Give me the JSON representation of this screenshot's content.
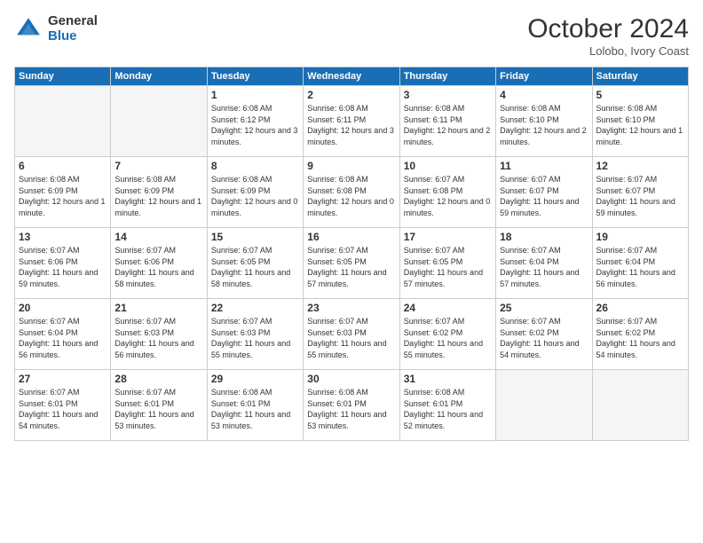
{
  "logo": {
    "general": "General",
    "blue": "Blue"
  },
  "header": {
    "month": "October 2024",
    "location": "Lolobo, Ivory Coast"
  },
  "weekdays": [
    "Sunday",
    "Monday",
    "Tuesday",
    "Wednesday",
    "Thursday",
    "Friday",
    "Saturday"
  ],
  "weeks": [
    [
      {
        "day": "",
        "info": ""
      },
      {
        "day": "",
        "info": ""
      },
      {
        "day": "1",
        "info": "Sunrise: 6:08 AM\nSunset: 6:12 PM\nDaylight: 12 hours\nand 3 minutes."
      },
      {
        "day": "2",
        "info": "Sunrise: 6:08 AM\nSunset: 6:11 PM\nDaylight: 12 hours\nand 3 minutes."
      },
      {
        "day": "3",
        "info": "Sunrise: 6:08 AM\nSunset: 6:11 PM\nDaylight: 12 hours\nand 2 minutes."
      },
      {
        "day": "4",
        "info": "Sunrise: 6:08 AM\nSunset: 6:10 PM\nDaylight: 12 hours\nand 2 minutes."
      },
      {
        "day": "5",
        "info": "Sunrise: 6:08 AM\nSunset: 6:10 PM\nDaylight: 12 hours\nand 1 minute."
      }
    ],
    [
      {
        "day": "6",
        "info": "Sunrise: 6:08 AM\nSunset: 6:09 PM\nDaylight: 12 hours\nand 1 minute."
      },
      {
        "day": "7",
        "info": "Sunrise: 6:08 AM\nSunset: 6:09 PM\nDaylight: 12 hours\nand 1 minute."
      },
      {
        "day": "8",
        "info": "Sunrise: 6:08 AM\nSunset: 6:09 PM\nDaylight: 12 hours\nand 0 minutes."
      },
      {
        "day": "9",
        "info": "Sunrise: 6:08 AM\nSunset: 6:08 PM\nDaylight: 12 hours\nand 0 minutes."
      },
      {
        "day": "10",
        "info": "Sunrise: 6:07 AM\nSunset: 6:08 PM\nDaylight: 12 hours\nand 0 minutes."
      },
      {
        "day": "11",
        "info": "Sunrise: 6:07 AM\nSunset: 6:07 PM\nDaylight: 11 hours\nand 59 minutes."
      },
      {
        "day": "12",
        "info": "Sunrise: 6:07 AM\nSunset: 6:07 PM\nDaylight: 11 hours\nand 59 minutes."
      }
    ],
    [
      {
        "day": "13",
        "info": "Sunrise: 6:07 AM\nSunset: 6:06 PM\nDaylight: 11 hours\nand 59 minutes."
      },
      {
        "day": "14",
        "info": "Sunrise: 6:07 AM\nSunset: 6:06 PM\nDaylight: 11 hours\nand 58 minutes."
      },
      {
        "day": "15",
        "info": "Sunrise: 6:07 AM\nSunset: 6:05 PM\nDaylight: 11 hours\nand 58 minutes."
      },
      {
        "day": "16",
        "info": "Sunrise: 6:07 AM\nSunset: 6:05 PM\nDaylight: 11 hours\nand 57 minutes."
      },
      {
        "day": "17",
        "info": "Sunrise: 6:07 AM\nSunset: 6:05 PM\nDaylight: 11 hours\nand 57 minutes."
      },
      {
        "day": "18",
        "info": "Sunrise: 6:07 AM\nSunset: 6:04 PM\nDaylight: 11 hours\nand 57 minutes."
      },
      {
        "day": "19",
        "info": "Sunrise: 6:07 AM\nSunset: 6:04 PM\nDaylight: 11 hours\nand 56 minutes."
      }
    ],
    [
      {
        "day": "20",
        "info": "Sunrise: 6:07 AM\nSunset: 6:04 PM\nDaylight: 11 hours\nand 56 minutes."
      },
      {
        "day": "21",
        "info": "Sunrise: 6:07 AM\nSunset: 6:03 PM\nDaylight: 11 hours\nand 56 minutes."
      },
      {
        "day": "22",
        "info": "Sunrise: 6:07 AM\nSunset: 6:03 PM\nDaylight: 11 hours\nand 55 minutes."
      },
      {
        "day": "23",
        "info": "Sunrise: 6:07 AM\nSunset: 6:03 PM\nDaylight: 11 hours\nand 55 minutes."
      },
      {
        "day": "24",
        "info": "Sunrise: 6:07 AM\nSunset: 6:02 PM\nDaylight: 11 hours\nand 55 minutes."
      },
      {
        "day": "25",
        "info": "Sunrise: 6:07 AM\nSunset: 6:02 PM\nDaylight: 11 hours\nand 54 minutes."
      },
      {
        "day": "26",
        "info": "Sunrise: 6:07 AM\nSunset: 6:02 PM\nDaylight: 11 hours\nand 54 minutes."
      }
    ],
    [
      {
        "day": "27",
        "info": "Sunrise: 6:07 AM\nSunset: 6:01 PM\nDaylight: 11 hours\nand 54 minutes."
      },
      {
        "day": "28",
        "info": "Sunrise: 6:07 AM\nSunset: 6:01 PM\nDaylight: 11 hours\nand 53 minutes."
      },
      {
        "day": "29",
        "info": "Sunrise: 6:08 AM\nSunset: 6:01 PM\nDaylight: 11 hours\nand 53 minutes."
      },
      {
        "day": "30",
        "info": "Sunrise: 6:08 AM\nSunset: 6:01 PM\nDaylight: 11 hours\nand 53 minutes."
      },
      {
        "day": "31",
        "info": "Sunrise: 6:08 AM\nSunset: 6:01 PM\nDaylight: 11 hours\nand 52 minutes."
      },
      {
        "day": "",
        "info": ""
      },
      {
        "day": "",
        "info": ""
      }
    ]
  ]
}
